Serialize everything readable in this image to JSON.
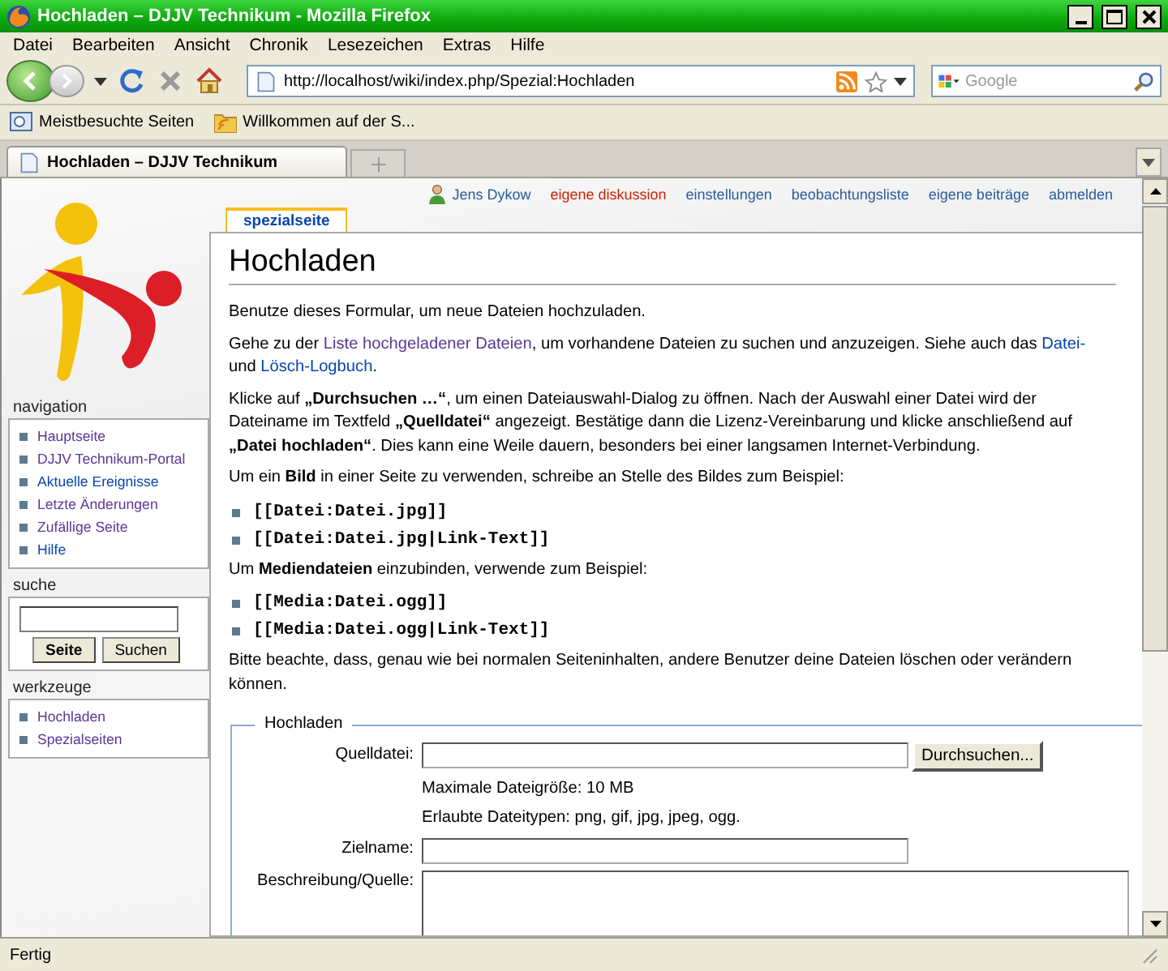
{
  "window": {
    "title": "Hochladen – DJJV Technikum - Mozilla Firefox"
  },
  "menu": [
    "Datei",
    "Bearbeiten",
    "Ansicht",
    "Chronik",
    "Lesezeichen",
    "Extras",
    "Hilfe"
  ],
  "navigation_toolbar": {
    "url": "http://localhost/wiki/index.php/Spezial:Hochladen",
    "search_placeholder": "Google"
  },
  "bookmarks": [
    {
      "label": "Meistbesuchte Seiten",
      "kind": "history"
    },
    {
      "label": "Willkommen auf der S...",
      "kind": "feed"
    }
  ],
  "tabs": [
    {
      "label": "Hochladen – DJJV Technikum",
      "selected": true
    }
  ],
  "personal_tools": [
    {
      "label": "Jens Dykow",
      "kind": "user",
      "new": false
    },
    {
      "label": "eigene diskussion",
      "kind": "link",
      "new": true
    },
    {
      "label": "einstellungen",
      "kind": "link",
      "new": false
    },
    {
      "label": "beobachtungsliste",
      "kind": "link",
      "new": false
    },
    {
      "label": "eigene beiträge",
      "kind": "link",
      "new": false
    },
    {
      "label": "abmelden",
      "kind": "link",
      "new": false
    }
  ],
  "sidebar": {
    "portlets": [
      {
        "kind": "links",
        "title": "navigation",
        "items": [
          {
            "label": "Hauptseite",
            "visited": true
          },
          {
            "label": "DJJV Technikum-Portal",
            "visited": true
          },
          {
            "label": "Aktuelle Ereignisse",
            "visited": false
          },
          {
            "label": "Letzte Änderungen",
            "visited": true
          },
          {
            "label": "Zufällige Seite",
            "visited": true
          },
          {
            "label": "Hilfe",
            "visited": false
          }
        ]
      },
      {
        "kind": "search",
        "title": "suche",
        "buttons": [
          {
            "label": "Seite",
            "default": true
          },
          {
            "label": "Suchen",
            "default": false
          }
        ]
      },
      {
        "kind": "links",
        "title": "werkzeuge",
        "items": [
          {
            "label": "Hochladen",
            "visited": true
          },
          {
            "label": "Spezialseiten",
            "visited": true
          }
        ]
      }
    ]
  },
  "page": {
    "tabs": [
      {
        "label": "spezialseite",
        "selected": true
      }
    ],
    "heading": "Hochladen",
    "blocks": [
      {
        "kind": "paragraph",
        "segments": [
          {
            "kind": "text",
            "text": "Benutze dieses Formular, um neue Dateien hochzuladen."
          }
        ]
      },
      {
        "kind": "paragraph",
        "segments": [
          {
            "kind": "text",
            "text": "Gehe zu der "
          },
          {
            "kind": "link",
            "text": "Liste hochgeladener Dateien",
            "visited": true
          },
          {
            "kind": "text",
            "text": ", um vorhandene Dateien zu suchen und anzuzeigen. Siehe auch das "
          },
          {
            "kind": "link",
            "text": "Datei-",
            "visited": false
          },
          {
            "kind": "text",
            "text": " und "
          },
          {
            "kind": "link",
            "text": "Lösch-Logbuch",
            "visited": false
          },
          {
            "kind": "text",
            "text": "."
          }
        ]
      },
      {
        "kind": "paragraph",
        "segments": [
          {
            "kind": "text",
            "text": "Klicke auf **„Durchsuchen …“**, um einen Dateiauswahl-Dialog zu öffnen. Nach der Auswahl einer Datei wird der Dateiname im Textfeld **„Quelldatei“** angezeigt. Bestätige dann die Lizenz-Vereinbarung und klicke anschließend auf **„Datei hochladen“**. Dies kann eine Weile dauern, besonders bei einer langsamen Internet-Verbindung."
          }
        ]
      },
      {
        "kind": "paragraph",
        "segments": [
          {
            "kind": "text",
            "text": "Um ein **Bild** in einer Seite zu verwenden, schreibe an Stelle des Bildes zum Beispiel:"
          }
        ]
      },
      {
        "kind": "code_list",
        "items": [
          "[[Datei:Datei.jpg]]",
          "[[Datei:Datei.jpg|Link-Text]]"
        ]
      },
      {
        "kind": "paragraph",
        "segments": [
          {
            "kind": "text",
            "text": "Um **Mediendateien** einzubinden, verwende zum Beispiel:"
          }
        ]
      },
      {
        "kind": "code_list",
        "items": [
          "[[Media:Datei.ogg]]",
          "[[Media:Datei.ogg|Link-Text]]"
        ]
      },
      {
        "kind": "paragraph",
        "segments": [
          {
            "kind": "text",
            "text": "Bitte beachte, dass, genau wie bei normalen Seiteninhalten, andere Benutzer deine Dateien löschen oder verändern können."
          }
        ]
      }
    ]
  },
  "form": {
    "legend": "Hochladen",
    "rows": [
      {
        "kind": "file",
        "label": "Quelldatei:",
        "button": "Durchsuchen..."
      },
      {
        "kind": "note",
        "text": "Maximale Dateigröße: 10 MB"
      },
      {
        "kind": "note",
        "text": "Erlaubte Dateitypen: png, gif, jpg, jpeg, ogg."
      },
      {
        "kind": "text",
        "label": "Zielname:"
      },
      {
        "kind": "textarea",
        "label": "Beschreibung/Quelle:"
      }
    ]
  },
  "status_bar": {
    "text": "Fertig"
  }
}
